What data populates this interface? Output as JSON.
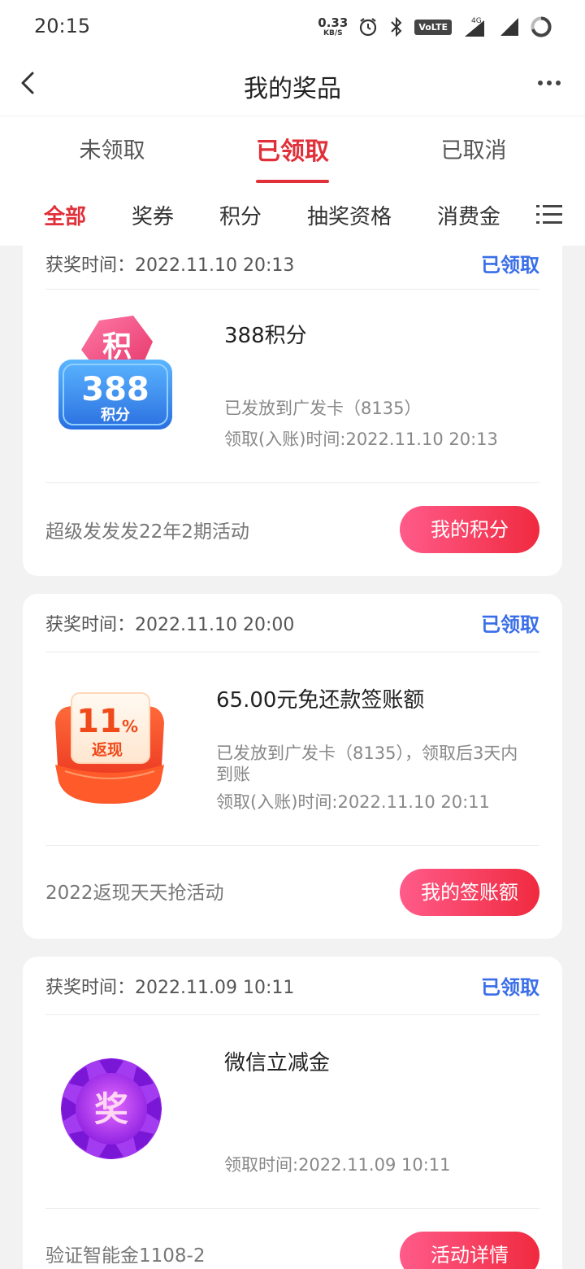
{
  "status_bar": {
    "time": "20:15",
    "net_speed_value": "0.33",
    "net_speed_unit": "KB/S",
    "volte": "VoLTE",
    "network": "4G"
  },
  "nav": {
    "title": "我的奖品"
  },
  "main_tabs": [
    "未领取",
    "已领取",
    "已取消"
  ],
  "sub_tabs": [
    "全部",
    "奖券",
    "积分",
    "抽奖资格",
    "消费金"
  ],
  "cards": [
    {
      "win_time": "获奖时间：2022.11.10 20:13",
      "status": "已领取",
      "image_text_top": "积",
      "image_text_number": "388",
      "image_text_bottom": "积分",
      "title": "388积分",
      "desc": "已发放到广发卡（8135）",
      "claim_time": "领取(入账)时间:2022.11.10 20:13",
      "activity": "超级发发发22年2期活动",
      "button": "我的积分"
    },
    {
      "win_time": "获奖时间：2022.11.10 20:00",
      "status": "已领取",
      "image_text_number": "11",
      "image_text_percent": "%",
      "image_text_bottom": "返现",
      "title": "65.00元免还款签账额",
      "desc_line1": "已发放到广发卡（8135），领取后3天内",
      "desc_line2": "到账",
      "claim_time": "领取(入账)时间:2022.11.10 20:11",
      "activity": "2022返现天天抢活动",
      "button": "我的签账额"
    },
    {
      "win_time": "获奖时间：2022.11.09 10:11",
      "status": "已领取",
      "image_text": "奖",
      "title": "微信立减金",
      "claim_time": "领取时间:2022.11.09 10:11",
      "activity": "验证智能金1108-2",
      "button": "活动详情"
    }
  ]
}
